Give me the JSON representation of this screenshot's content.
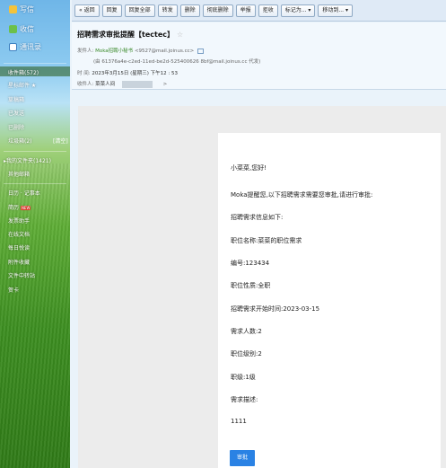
{
  "sidebar": {
    "write": "写信",
    "inbox": "收信",
    "contacts": "通讯录",
    "folders": [
      {
        "label": "收件箱(572)"
      },
      {
        "label": "星标邮件 ★"
      },
      {
        "label": "草稿箱"
      },
      {
        "label": "已发送"
      },
      {
        "label": "已删除"
      },
      {
        "label": "垃圾箱(2)"
      }
    ],
    "empty_link": "[清空]",
    "my_folders": "▸我的文件夹(1421)",
    "other_mailbox": "其他邮箱",
    "tools": [
      {
        "label": "日历 · 记事本"
      },
      {
        "label": "简历"
      },
      {
        "label": "发票助手"
      },
      {
        "label": "在线文档"
      },
      {
        "label": "每日悦读"
      },
      {
        "label": "附件收藏"
      },
      {
        "label": "文件中转站"
      },
      {
        "label": "贺卡"
      }
    ],
    "new_badge": "NEW"
  },
  "toolbar": {
    "back": "« 返回",
    "reply": "回复",
    "reply_all": "回复全部",
    "forward": "转发",
    "delete": "删除",
    "delete_forever": "彻底删除",
    "report": "举报",
    "reject": "拒收",
    "mark_as": "标记为... ▾",
    "move_to": "移动到... ▾"
  },
  "email": {
    "subject": "招聘需求审批提醒【tectec】",
    "star": "☆",
    "from_label": "发件人:",
    "from_name": "Moka招聘小秘书",
    "from_addr": "<9527@mail.joinus.cc>",
    "proxy": "(由 61376a4e-c2ed-11ed-be2d-525400626 8bf@mail.joinus.cc 代发)",
    "time_label": "时   间:",
    "time": "2023年3月15日 (星期三) 下午12 : 53",
    "to_label": "收件人:",
    "to_name": "菜菜人间",
    "to_tail": ">"
  },
  "body": {
    "greeting": "小菜菜,您好!",
    "intro": "Moka提醒您,以下招聘需求需要您审批,请进行审批:",
    "info_title": "招聘需求信息如下:",
    "position": "职位名称:菜菜的职位需求",
    "number": "编号:123434",
    "nature": "职位性质:全职",
    "start_time": "招聘需求开始时间:2023-03-15",
    "headcount": "需求人数:2",
    "level": "职位级别:2",
    "rank": "职级:1级",
    "desc_label": "需求描述:",
    "desc": "1111",
    "approve_button": "审批"
  }
}
